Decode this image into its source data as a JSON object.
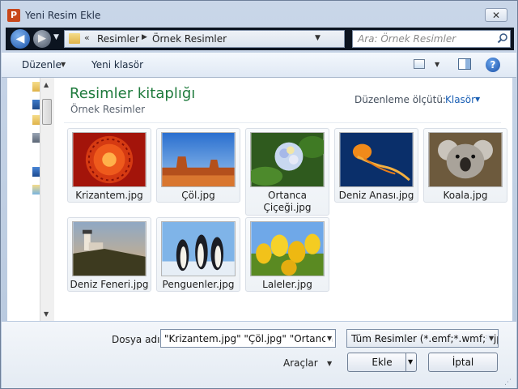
{
  "window": {
    "title": "Yeni Resim Ekle",
    "app_icon_letter": "P",
    "close_glyph": "✕"
  },
  "address": {
    "separator": "«",
    "breadcrumbs": [
      "Resimler",
      "Örnek Resimler"
    ],
    "crumb_arrow": "▶",
    "search_placeholder": "Ara: Örnek Resimler"
  },
  "toolbar": {
    "organize_label": "Düzenle",
    "new_folder_label": "Yeni klasör",
    "help_glyph": "?"
  },
  "library": {
    "title": "Resimler kitaplığı",
    "subtitle": "Örnek Resimler",
    "arrange_label": "Düzenleme ölçütü:",
    "arrange_value": "Klasör"
  },
  "files": [
    {
      "name": "Krizantem.jpg"
    },
    {
      "name": "Çöl.jpg"
    },
    {
      "name": "Ortanca Çiçeği.jpg"
    },
    {
      "name": "Deniz Anası.jpg"
    },
    {
      "name": "Koala.jpg"
    },
    {
      "name": "Deniz Feneri.jpg"
    },
    {
      "name": "Penguenler.jpg"
    },
    {
      "name": "Laleler.jpg"
    }
  ],
  "bottom": {
    "filename_label": "Dosya adı:",
    "filename_value": "\"Krizantem.jpg\" \"Çöl.jpg\" \"Ortanca Ç",
    "filetype_value": "Tüm Resimler (*.emf;*.wmf;*.jp",
    "tools_label": "Araçlar",
    "insert_label": "Ekle",
    "cancel_label": "İptal"
  },
  "colors": {
    "library_title": "#1e7a3c",
    "link_blue": "#1a5fb4",
    "address_bg": "#0c1420"
  }
}
